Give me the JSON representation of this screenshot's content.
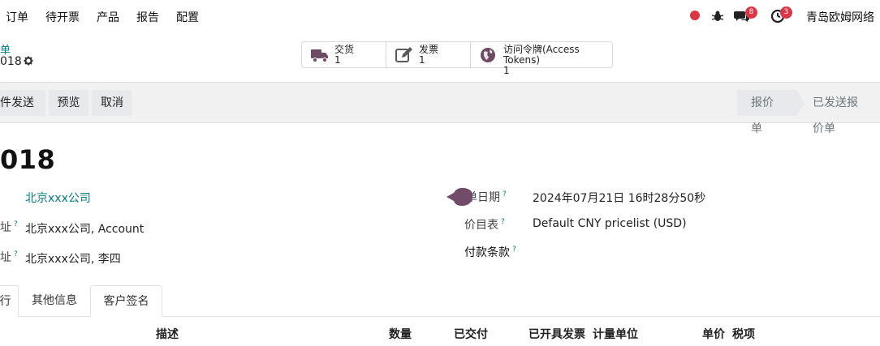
{
  "navbar": {
    "menu": [
      "订单",
      "待开票",
      "产品",
      "报告",
      "配置"
    ],
    "messages_badge": "8",
    "activities_badge": "3",
    "company": "青岛欧姆网络"
  },
  "header": {
    "breadcrumb": "单",
    "record_name": "018"
  },
  "smart_buttons": [
    {
      "label": "交货",
      "count": "1",
      "icon": "truck-icon"
    },
    {
      "label": "发票",
      "count": "1",
      "icon": "invoice-edit-icon"
    },
    {
      "label": "访问令牌(Access Tokens)",
      "count": "1",
      "icon": "globe-icon"
    }
  ],
  "control": {
    "send_email": "件发送",
    "preview": "预览",
    "cancel": "取消"
  },
  "statusbar": {
    "stages": [
      "报价单",
      "已发送报价单"
    ]
  },
  "form": {
    "title": "018",
    "customer_value": "北京xxx公司",
    "invoice_label_tail": "址",
    "invoice_value": "北京xxx公司, Account",
    "delivery_label_tail": "址",
    "delivery_value": "北京xxx公司, 李四",
    "date_label": "订单日期",
    "date_value": "2024年07月21日 16时28分50秒",
    "pricelist_label": "价目表",
    "pricelist_value": "Default CNY pricelist (USD)",
    "payment_terms_label": "付款条款",
    "tooltip_mark": "?"
  },
  "tabs": [
    "行",
    "其他信息",
    "客户签名"
  ],
  "table": {
    "columns": [
      "描述",
      "数量",
      "已交付",
      "已开具发票",
      "计量单位",
      "单价",
      "税项"
    ]
  },
  "colors": {
    "accent": "#017e84",
    "badge": "#dc3545",
    "blob": "#714b67"
  }
}
